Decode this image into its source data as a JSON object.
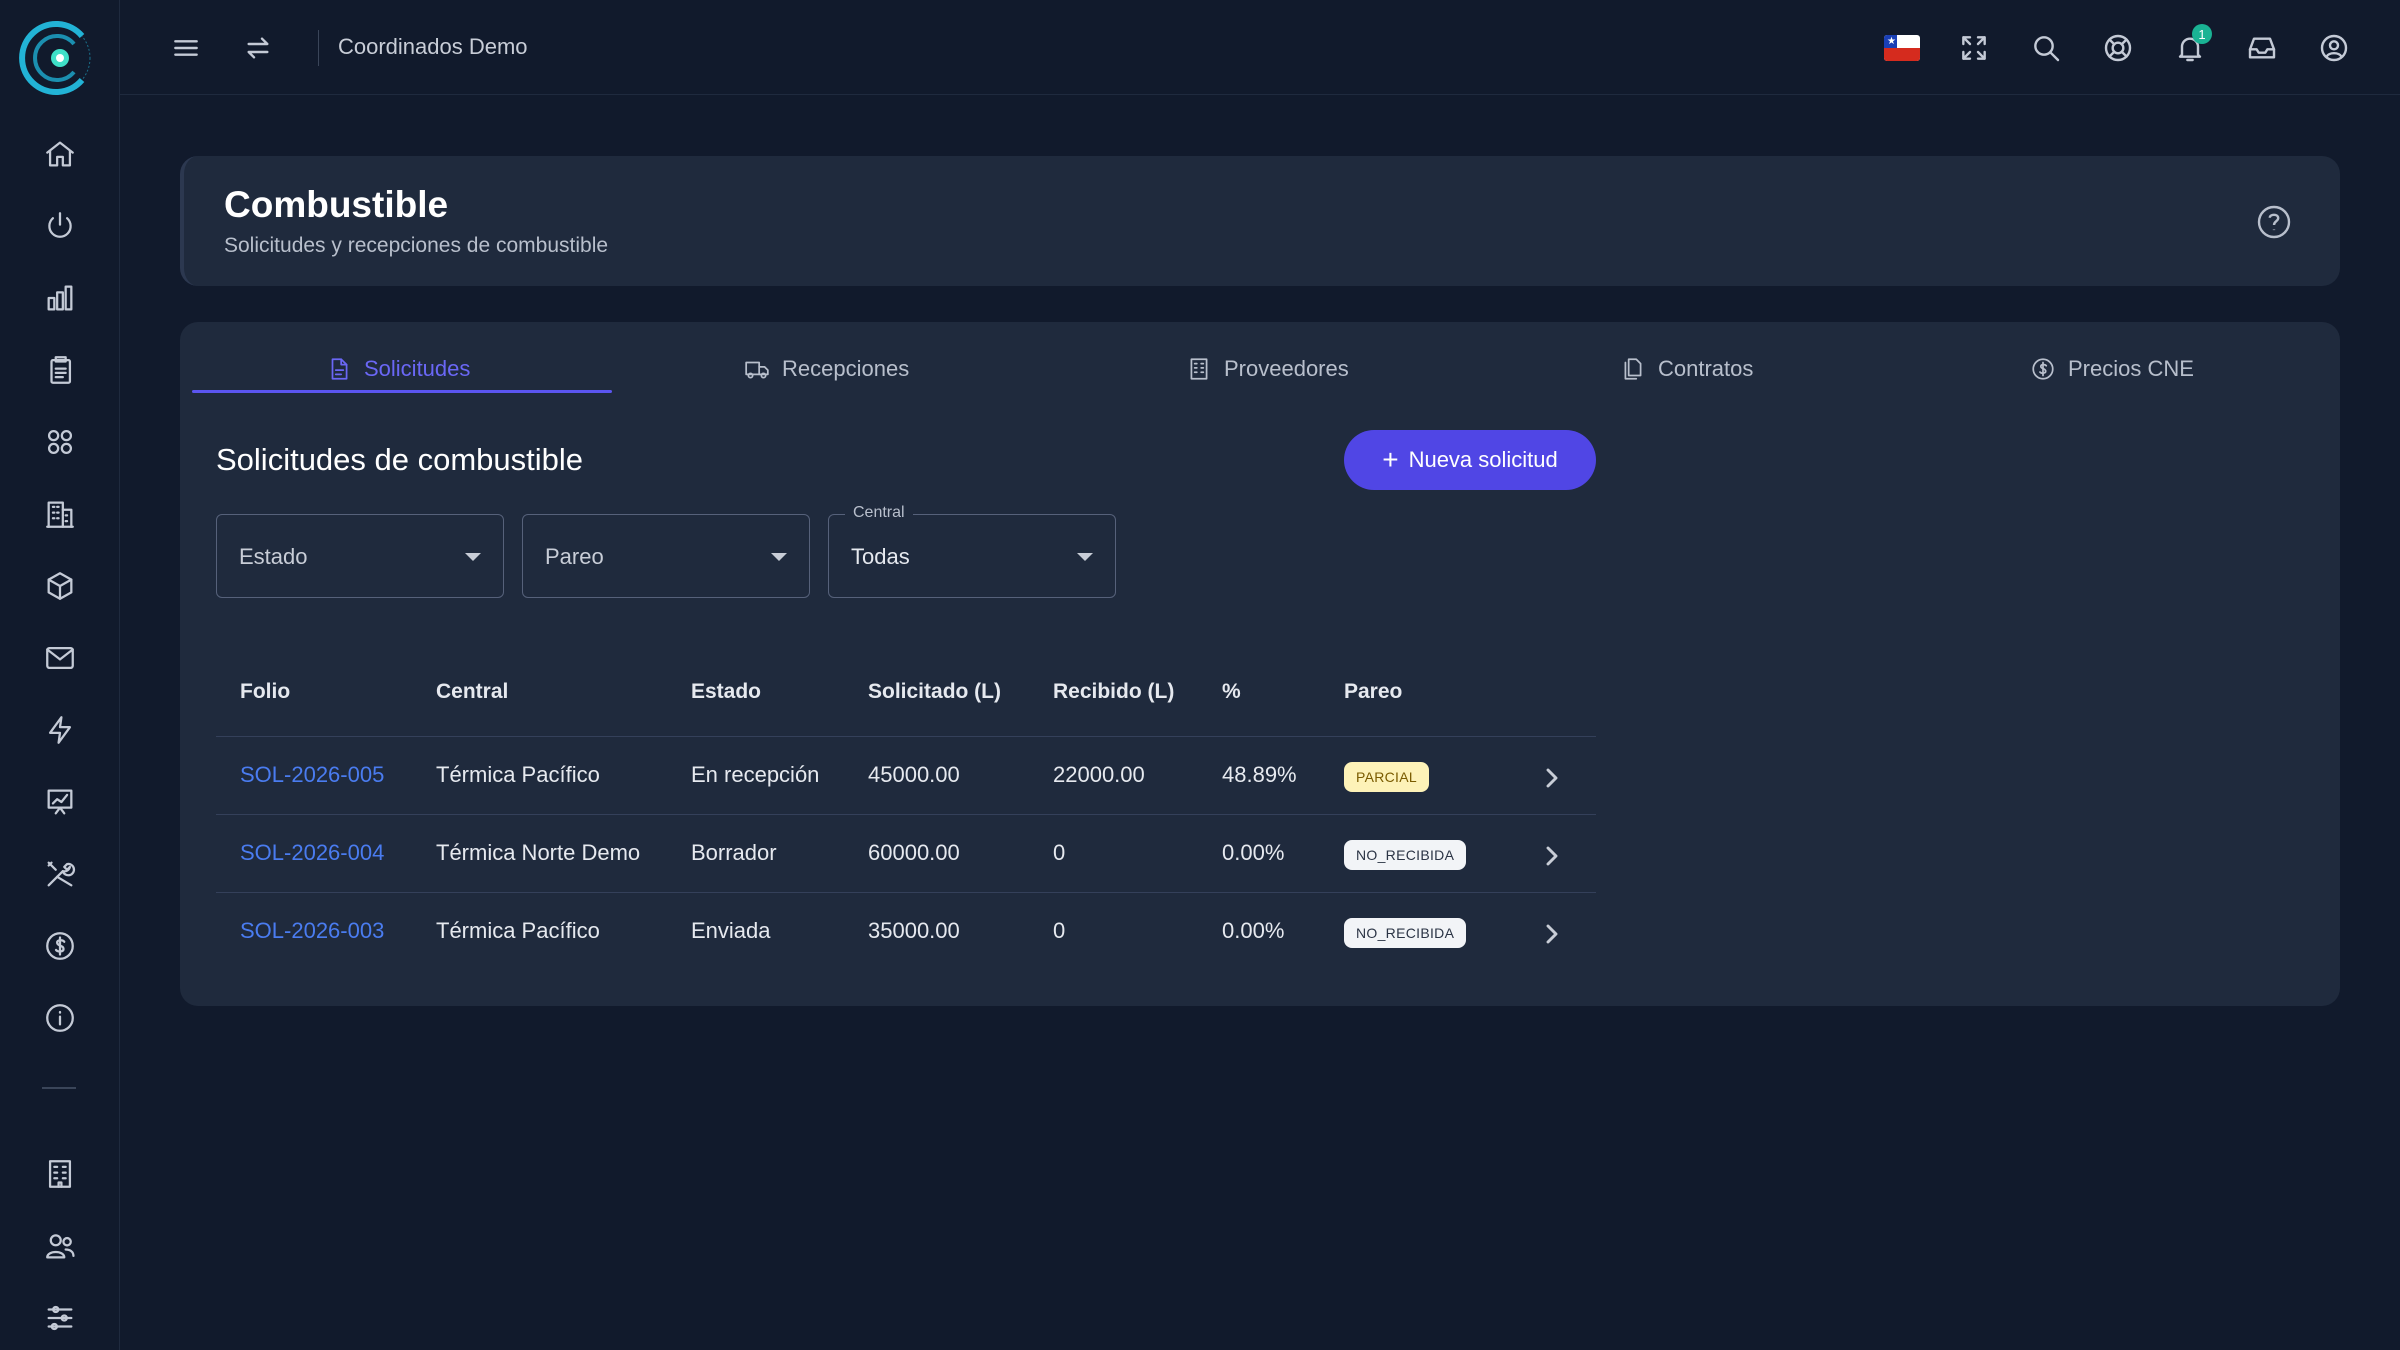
{
  "topbar": {
    "title": "Coordinados Demo",
    "notification_count": "1",
    "icons": [
      "menu-icon",
      "swap-icon",
      "flag-chile-icon",
      "fullscreen-icon",
      "search-icon",
      "support-icon",
      "bell-icon",
      "inbox-icon",
      "user-icon"
    ]
  },
  "sidebar": {
    "icons": [
      "home-icon",
      "power-icon",
      "bar-chart-icon",
      "clipboard-icon",
      "grid-icon",
      "building-icon",
      "cube-icon",
      "mail-icon",
      "bolt-icon",
      "presentation-chart-icon",
      "tools-icon",
      "dollar-icon",
      "info-icon",
      "office-icon",
      "users-icon",
      "sliders-icon"
    ]
  },
  "header": {
    "title": "Combustible",
    "subtitle": "Solicitudes y recepciones de combustible"
  },
  "tabs": [
    {
      "label": "Solicitudes",
      "active": true
    },
    {
      "label": "Recepciones",
      "active": false
    },
    {
      "label": "Proveedores",
      "active": false
    },
    {
      "label": "Contratos",
      "active": false
    },
    {
      "label": "Precios CNE",
      "active": false
    }
  ],
  "section": {
    "title": "Solicitudes de combustible",
    "new_button": "Nueva solicitud"
  },
  "filters": {
    "estado": {
      "placeholder": "Estado"
    },
    "pareo": {
      "placeholder": "Pareo"
    },
    "central": {
      "label": "Central",
      "value": "Todas"
    }
  },
  "table": {
    "headers": [
      "Folio",
      "Central",
      "Estado",
      "Solicitado (L)",
      "Recibido (L)",
      "%",
      "Pareo"
    ],
    "rows": [
      {
        "folio": "SOL-2026-005",
        "central": "Térmica Pacífico",
        "estado": "En recepción",
        "solicitado": "45000.00",
        "recibido": "22000.00",
        "pct": "48.89%",
        "pareo": "PARCIAL"
      },
      {
        "folio": "SOL-2026-004",
        "central": "Térmica Norte Demo",
        "estado": "Borrador",
        "solicitado": "60000.00",
        "recibido": "0",
        "pct": "0.00%",
        "pareo": "NO_RECIBIDA"
      },
      {
        "folio": "SOL-2026-003",
        "central": "Térmica Pacífico",
        "estado": "Enviada",
        "solicitado": "35000.00",
        "recibido": "0",
        "pct": "0.00%",
        "pareo": "NO_RECIBIDA"
      }
    ]
  },
  "colors": {
    "background": "#111a2c",
    "card": "#1f2a3d",
    "accent": "#5046e5",
    "link": "#4a7cf0",
    "badge_parcial": "#fdf2b8",
    "badge_norecibida": "#f2f4f7",
    "notification": "#1ab394"
  }
}
